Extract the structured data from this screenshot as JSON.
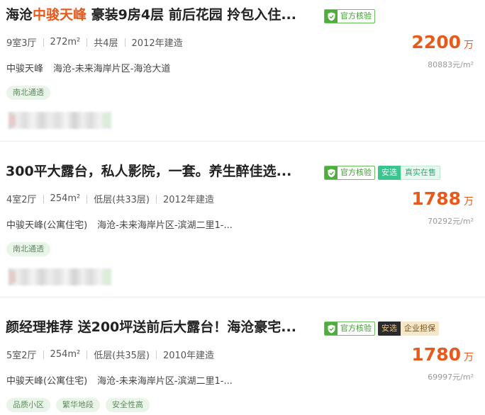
{
  "listings": [
    {
      "title_pre": "海沧",
      "title_hl": "中骏天峰",
      "title_post": " 豪装9房4层 前后花园 拎包入住...",
      "verify_label": "官方核验",
      "badge_a": "",
      "badge_b": "",
      "info": [
        "9室3厅",
        "272m²",
        "共4层",
        "2012年建造"
      ],
      "community": "中骏天峰",
      "area": "海沧-未来海岸片区-海沧大道",
      "features": [
        "南北通透"
      ],
      "price": "2200",
      "price_unit": "万",
      "unit_price": "80883元/m²"
    },
    {
      "title_pre": "300平大露台，私人影院，一套。养生醉佳选...",
      "title_hl": "",
      "title_post": "",
      "verify_label": "官方核验",
      "badge_a": "安选",
      "badge_b": "真实在售",
      "info": [
        "4室2厅",
        "254m²",
        "低层(共33层)",
        "2012年建造"
      ],
      "community": "中骏天峰(公寓住宅)",
      "area": "海沧-未来海岸片区-滨湖二里1-...",
      "features": [
        "南北通透"
      ],
      "price": "1788",
      "price_unit": "万",
      "unit_price": "70292元/m²"
    },
    {
      "title_pre": "颜经理推荐 送200坪送前后大露台！海沧豪宅...",
      "title_hl": "",
      "title_post": "",
      "verify_label": "官方核验",
      "badge_a": "安选",
      "badge_b": "企业担保",
      "info": [
        "5室2厅",
        "254m²",
        "低层(共35层)",
        "2010年建造"
      ],
      "community": "中骏天峰(公寓住宅)",
      "area": "海沧-未来海岸片区-滨湖二里1-...",
      "features": [
        "品质小区",
        "繁华地段",
        "安全性高"
      ],
      "price": "1780",
      "price_unit": "万",
      "unit_price": "69997元/m²"
    }
  ],
  "colors": {
    "accent": "#e8591c",
    "verify": "#4ead3c",
    "anxuan_green": "#3bc48e",
    "anxuan_dark": "#2b2b2b"
  },
  "icons": {
    "verify": "shield-check-icon"
  }
}
